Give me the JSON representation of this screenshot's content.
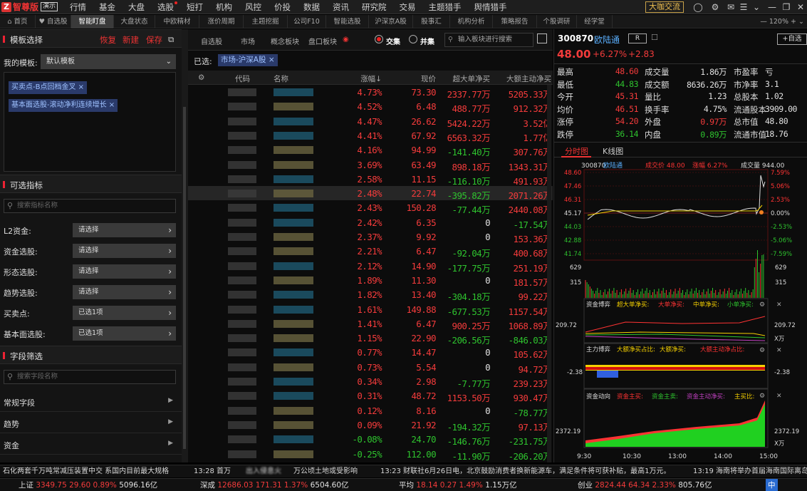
{
  "app": {
    "logo_mark": "Z",
    "name": "智尊版",
    "mode": "演示"
  },
  "menu": [
    "行情",
    "基金",
    "大盘",
    "选股",
    "短打",
    "机构",
    "风控",
    "价投",
    "数据",
    "资讯",
    "研究院",
    "交易",
    "主题猎手",
    "舆情猎手"
  ],
  "menu_dot_item": "选股",
  "top_right": {
    "big_coffee": "大咖交流"
  },
  "tabs": [
    "首页",
    "自选股",
    "智能盯盘",
    "大盘状态",
    "中欧精材",
    "涨价周期",
    "主题挖掘",
    "公司F10",
    "智能选股",
    "沪深京A股",
    "股事汇",
    "机构分析",
    "策略报告",
    "个股调研",
    "经学堂"
  ],
  "active_tab": 2,
  "zoom": "120%",
  "left": {
    "template_title": "模板选择",
    "restore": "恢复",
    "new": "新建",
    "save": "保存",
    "my_template_label": "我的模板:",
    "my_template_value": "默认模板",
    "tags": [
      "买卖点-B点回档金叉",
      "基本面选股-滚动净利连续增长"
    ],
    "indicator_title": "可选指标",
    "indicator_search": "搜索指标名称",
    "filters": [
      {
        "label": "L2资金:",
        "value": "请选择"
      },
      {
        "label": "资金选股:",
        "value": "请选择"
      },
      {
        "label": "形态选股:",
        "value": "请选择"
      },
      {
        "label": "趋势选股:",
        "value": "请选择"
      },
      {
        "label": "买卖点:",
        "value": "已选1项"
      },
      {
        "label": "基本面选股:",
        "value": "已选1项"
      }
    ],
    "field_title": "字段筛选",
    "field_search": "搜索字段名称",
    "field_groups": [
      "常规字段",
      "趋势",
      "资金"
    ]
  },
  "mid": {
    "toolbar": [
      "自选股",
      "市场",
      "概念板块",
      "盘口板块"
    ],
    "radio_on": "交集",
    "radio_off": "并集",
    "search_placeholder": "输入板块进行搜索",
    "selected_label": "已选:",
    "selected_tag": "市场-沪深A股",
    "headers": {
      "code": "代码",
      "name": "名称",
      "change": "涨幅↓",
      "price": "现价",
      "super": "超大单净买",
      "main": "大额主动净买"
    },
    "rows": [
      {
        "change": "4.73%",
        "price": "73.30",
        "super": "2337.77万",
        "main": "5205.33万"
      },
      {
        "change": "4.52%",
        "price": "6.48",
        "super": "488.77万",
        "main": "912.32万"
      },
      {
        "change": "4.47%",
        "price": "26.62",
        "super": "5424.22万",
        "main": "3.52亿"
      },
      {
        "change": "4.41%",
        "price": "67.92",
        "super": "6563.32万",
        "main": "1.77亿"
      },
      {
        "change": "4.16%",
        "price": "94.99",
        "super": "-141.40万",
        "main": "307.76万"
      },
      {
        "change": "3.69%",
        "price": "63.49",
        "super": "898.18万",
        "main": "1343.31万"
      },
      {
        "change": "2.58%",
        "price": "11.15",
        "super": "-116.10万",
        "main": "491.93万"
      },
      {
        "change": "2.48%",
        "price": "22.74",
        "super": "-395.82万",
        "main": "2071.26万"
      },
      {
        "change": "2.43%",
        "price": "150.28",
        "super": "-77.44万",
        "main": "2440.08万"
      },
      {
        "change": "2.42%",
        "price": "6.35",
        "super": "0",
        "main": "-17.54万"
      },
      {
        "change": "2.37%",
        "price": "9.92",
        "super": "0",
        "main": "153.36万"
      },
      {
        "change": "2.21%",
        "price": "6.47",
        "super": "-92.04万",
        "main": "400.68万"
      },
      {
        "change": "2.12%",
        "price": "14.90",
        "super": "-177.75万",
        "main": "251.19万"
      },
      {
        "change": "1.89%",
        "price": "11.30",
        "super": "0",
        "main": "181.57万"
      },
      {
        "change": "1.82%",
        "price": "13.40",
        "super": "-304.18万",
        "main": "99.22万"
      },
      {
        "change": "1.61%",
        "price": "149.88",
        "super": "-677.53万",
        "main": "1157.54万"
      },
      {
        "change": "1.41%",
        "price": "6.47",
        "super": "900.25万",
        "main": "1068.89万"
      },
      {
        "change": "1.15%",
        "price": "22.90",
        "super": "-206.56万",
        "main": "-846.03万"
      },
      {
        "change": "0.77%",
        "price": "14.47",
        "super": "0",
        "main": "105.62万"
      },
      {
        "change": "0.73%",
        "price": "5.54",
        "super": "0",
        "main": "94.72万"
      },
      {
        "change": "0.34%",
        "price": "2.98",
        "super": "-7.77万",
        "main": "239.23万"
      },
      {
        "change": "0.31%",
        "price": "48.72",
        "super": "1153.50万",
        "main": "930.47万"
      },
      {
        "change": "0.12%",
        "price": "8.16",
        "super": "0",
        "main": "-78.77万"
      },
      {
        "change": "0.09%",
        "price": "21.92",
        "super": "-194.32万",
        "main": "97.13万"
      },
      {
        "change": "-0.08%",
        "price": "24.70",
        "super": "-146.76万",
        "main": "-231.75万"
      },
      {
        "change": "-0.25%",
        "price": "112.00",
        "super": "-11.90万",
        "main": "-206.20万"
      }
    ]
  },
  "right": {
    "code": "300870",
    "name": "欧陆通",
    "badge": "R",
    "add_watch": "+自选",
    "price": "48.00",
    "pct": "+6.27%",
    "chg": "+2.83",
    "quote": [
      [
        "最高",
        "48.60",
        "成交量",
        "1.86万",
        "市盈率",
        "亏"
      ],
      [
        "最低",
        "44.83",
        "成交额",
        "8636.26万",
        "市净率",
        "3.1"
      ],
      [
        "今开",
        "45.31",
        "量比",
        "1.23",
        "总股本",
        "1.02"
      ],
      [
        "均价",
        "46.51",
        "换手率",
        "4.75%",
        "流通股本",
        "3909.00"
      ],
      [
        "涨停",
        "54.20",
        "外盘",
        "0.97万",
        "总市值",
        "48.80"
      ],
      [
        "跌停",
        "36.14",
        "内盘",
        "0.89万",
        "流通市值",
        "18.76"
      ]
    ],
    "chart_tabs": [
      "分时图",
      "K线图"
    ],
    "intraday_header": {
      "code": "300870",
      "name": "欧陆通",
      "avg": "成交价 48.00",
      "pct": "涨幅 6.27%",
      "vol": "成交量 944.00"
    },
    "price_ticks": [
      "48.60",
      "47.46",
      "46.31",
      "45.17",
      "44.03",
      "42.88",
      "41.74"
    ],
    "pct_ticks": [
      "7.59%",
      "5.06%",
      "2.53%",
      "0.00%",
      "-2.53%",
      "-5.06%",
      "-7.59%"
    ],
    "vol_ticks": [
      "629",
      "315"
    ],
    "panel1": {
      "title": "资金博弈",
      "legend": [
        "超大单净买:",
        "大单净买:",
        "中单净买:",
        "小单净买:"
      ],
      "val": "209.72",
      "unit": "X万"
    },
    "panel2": {
      "title": "主力博弈",
      "legend": [
        "大额净买占比:",
        "大额净买:",
        "大额主动净占比:"
      ],
      "val": "-2.38"
    },
    "panel3": {
      "title": "资金动向",
      "legend": [
        "资金主买:",
        "资金主卖:",
        "资金主动净买:",
        "主买比:"
      ],
      "val": "2372.19",
      "unit": "X万"
    },
    "time_ticks": [
      "9:30",
      "10:30",
      "13:00",
      "14:00",
      "15:00"
    ]
  },
  "ticker": [
    "石化两套千万吨常减压装置中交 系国内目前最大规格",
    "13:28 首万",
    "出入侵息火",
    "万公顷土地或受影响",
    "13:23 财联社6月26日电，北京鼓励消费者换新能源车，满足条件将可获补贴，最高1万元。",
    "13:19 海南将举办首届海南国际离岛"
  ],
  "indices": [
    {
      "name": "上证",
      "val": "3349.75",
      "chg": "29.60",
      "pct": "0.89%",
      "amt": "5096.16亿"
    },
    {
      "name": "深成",
      "val": "12686.03",
      "chg": "171.31",
      "pct": "1.37%",
      "amt": "6504.60亿"
    },
    {
      "name": "平均",
      "val": "18.14",
      "chg": "0.27",
      "pct": "1.49%",
      "amt": "1.15万亿"
    },
    {
      "name": "创业",
      "val": "2824.44",
      "chg": "64.34",
      "pct": "2.33%",
      "amt": "805.76亿"
    }
  ],
  "ime": "中"
}
